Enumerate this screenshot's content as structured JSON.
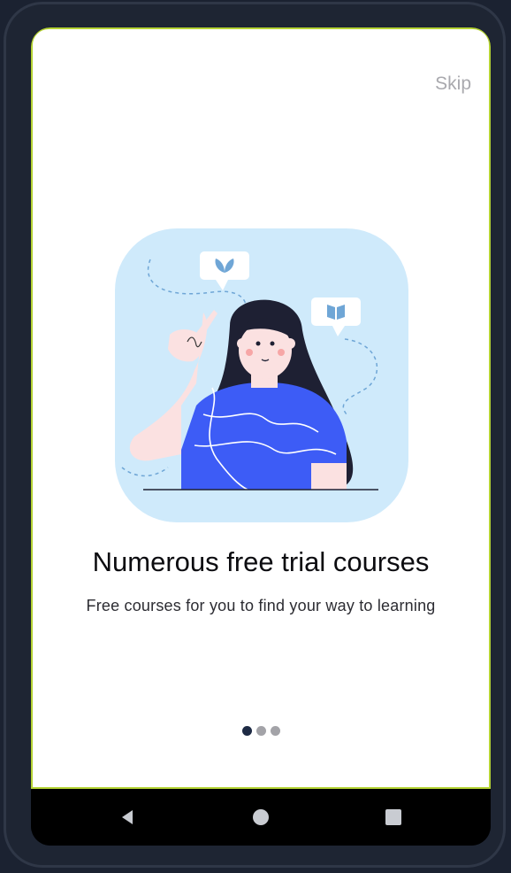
{
  "header": {
    "skip_label": "Skip"
  },
  "onboarding": {
    "title": "Numerous free trial courses",
    "subtitle": "Free courses for you to find your way to learning",
    "page_indicator": {
      "total": 3,
      "current": 1
    }
  },
  "navbar": {
    "back_icon": "back-triangle-icon",
    "home_icon": "home-circle-icon",
    "recents_icon": "recents-square-icon"
  },
  "colors": {
    "background_frame": "#1b2231",
    "accent_border": "#b5d334",
    "illustration_bg": "#cfeafb",
    "shirt_blue": "#3d5cf6",
    "hair_dark": "#1e2033",
    "dot_active": "#1d2a44",
    "dot_inactive": "#a3a3a8"
  }
}
